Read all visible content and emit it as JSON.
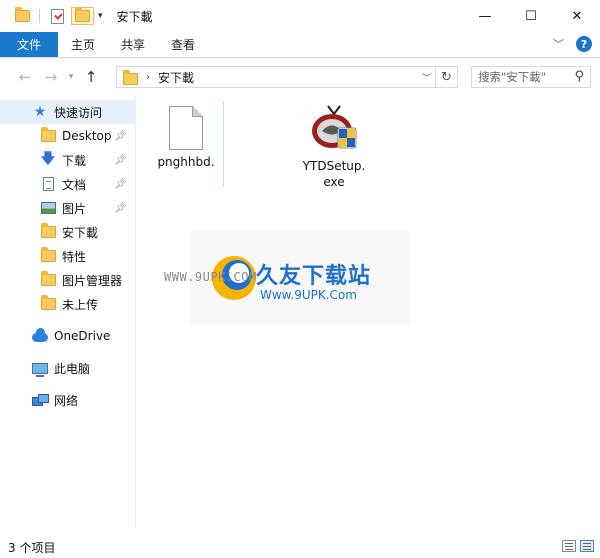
{
  "window": {
    "title": "安下載",
    "controls": {
      "minimize": "—",
      "maximize": "☐",
      "close": "✕"
    }
  },
  "ribbon": {
    "tabs": [
      "文件",
      "主页",
      "共享",
      "查看"
    ],
    "help": "?"
  },
  "navigation": {
    "back": "←",
    "forward": "→",
    "up": "↑",
    "refresh": "↻",
    "breadcrumb": [
      "安下載"
    ],
    "search_placeholder": "搜索\"安下載\""
  },
  "sidebar": {
    "quick_access": "快速访问",
    "items": [
      {
        "label": "Desktop",
        "icon": "folder-icon",
        "pinned": true
      },
      {
        "label": "下载",
        "icon": "download-icon",
        "pinned": true
      },
      {
        "label": "文档",
        "icon": "document-icon",
        "pinned": true
      },
      {
        "label": "图片",
        "icon": "pictures-icon",
        "pinned": true
      },
      {
        "label": "安下載",
        "icon": "folder-icon",
        "pinned": false
      },
      {
        "label": "特性",
        "icon": "folder-icon",
        "pinned": false
      },
      {
        "label": "图片管理器",
        "icon": "folder-icon",
        "pinned": false
      },
      {
        "label": "未上传",
        "icon": "folder-icon",
        "pinned": false
      }
    ],
    "onedrive": "OneDrive",
    "this_pc": "此电脑",
    "network": "网络"
  },
  "files": [
    {
      "name": "pnghhbd.",
      "icon": "blank-file-icon"
    },
    {
      "name": "YTDSetup.\nexe",
      "icon": "installer-icon"
    }
  ],
  "watermark": {
    "url_left": "WWW.9UPK.COM",
    "name_cn": "久友下载站",
    "url_right": "Www.9UPK.Com"
  },
  "status": {
    "item_count": "3 个项目"
  },
  "colors": {
    "ribbon_file_tab": "#1979ca",
    "selected_nav": "#e5f0fb",
    "folder": "#f8cb5a",
    "watermark_blue": "#1f6fd0"
  }
}
